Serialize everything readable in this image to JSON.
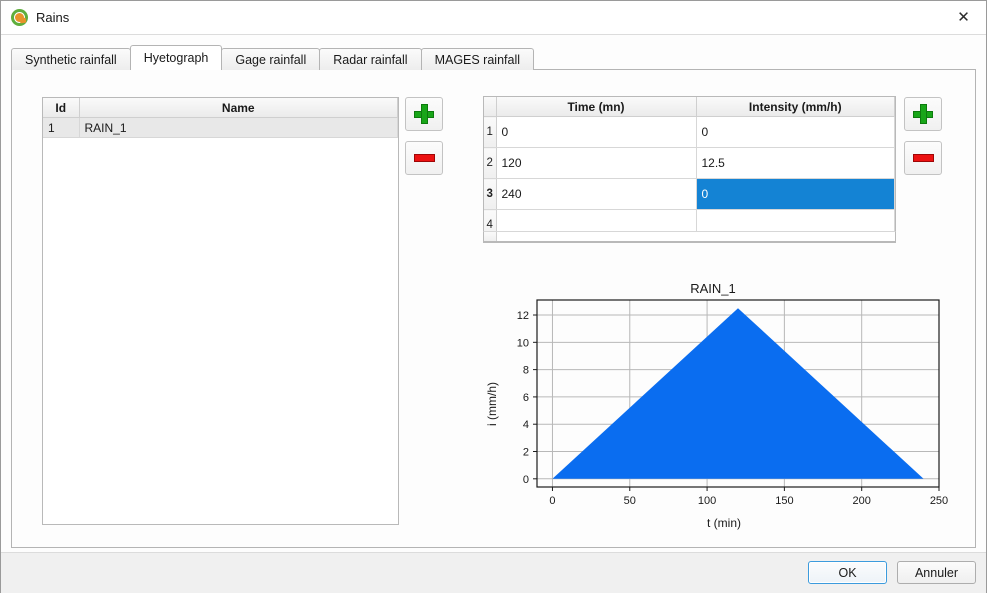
{
  "window": {
    "title": "Rains",
    "app_icon": "qgis-logo-icon",
    "close_icon": "close-icon"
  },
  "tabs": [
    {
      "label": "Synthetic rainfall",
      "active": false
    },
    {
      "label": "Hyetograph",
      "active": true
    },
    {
      "label": "Gage rainfall",
      "active": false
    },
    {
      "label": "Radar rainfall",
      "active": false
    },
    {
      "label": "MAGES rainfall",
      "active": false
    }
  ],
  "rains_table": {
    "columns": [
      "Id",
      "Name"
    ],
    "rows": [
      {
        "id": "1",
        "name": "RAIN_1",
        "selected": true
      }
    ]
  },
  "rains_buttons": {
    "add": {
      "icon": "plus-icon",
      "label": ""
    },
    "remove": {
      "icon": "minus-icon",
      "label": ""
    }
  },
  "hyeto_table": {
    "columns": [
      "Time (mn)",
      "Intensity (mm/h)"
    ],
    "rows": [
      {
        "num": "1",
        "time": "0",
        "intensity": "0",
        "selected_cell": null
      },
      {
        "num": "2",
        "time": "120",
        "intensity": "12.5",
        "selected_cell": null
      },
      {
        "num": "3",
        "time": "240",
        "intensity": "0",
        "selected_cell": "intensity"
      },
      {
        "num": "4",
        "time": "",
        "intensity": "",
        "selected_cell": null
      }
    ],
    "selection_color": "#1483d4"
  },
  "hyeto_buttons": {
    "add": {
      "icon": "plus-icon",
      "label": ""
    },
    "remove": {
      "icon": "minus-icon",
      "label": ""
    }
  },
  "chart_data": {
    "type": "area",
    "title": "RAIN_1",
    "xlabel": "t (min)",
    "ylabel": "i (mm/h)",
    "x": [
      0,
      120,
      240
    ],
    "values": [
      0,
      12.5,
      0
    ],
    "series": [
      {
        "name": "RAIN_1",
        "values": [
          0,
          12.5,
          0
        ]
      }
    ],
    "xlim": [
      -10,
      250
    ],
    "ylim": [
      -0.6,
      13.1
    ],
    "xticks": [
      0,
      50,
      100,
      150,
      200,
      250
    ],
    "yticks": [
      0,
      2,
      4,
      6,
      8,
      10,
      12
    ],
    "grid": true,
    "legend": "none",
    "fill_color": "#0a6df0",
    "grid_color": "#b8b8b8"
  },
  "dialog_buttons": {
    "ok": "OK",
    "cancel": "Annuler"
  }
}
